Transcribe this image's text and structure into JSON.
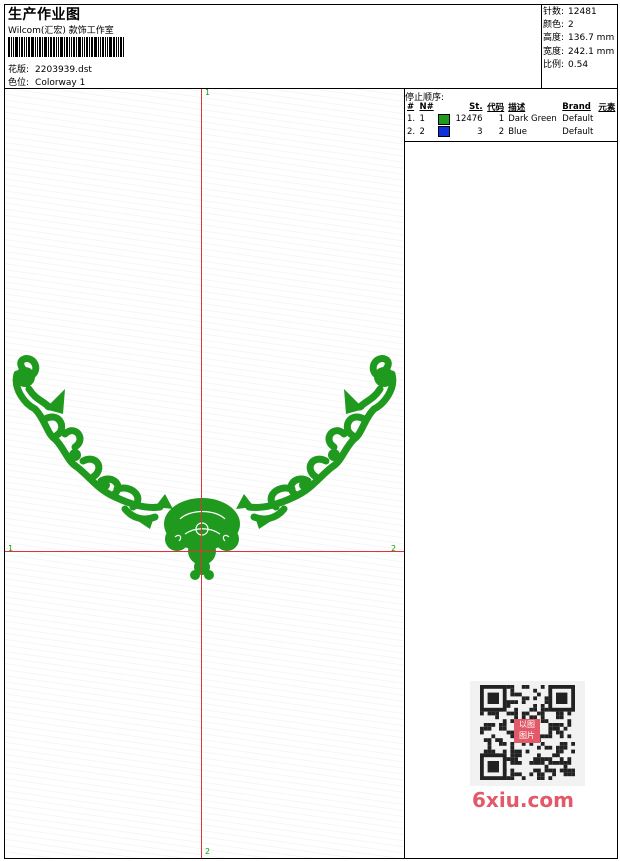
{
  "header": {
    "title": "生产作业图",
    "studio": "Wilcom(汇宏) 款饰工作室",
    "design_label": "花版:",
    "design_value": "2203939.dst",
    "colorway_label": "色位:",
    "colorway_value": "Colorway 1"
  },
  "stats": {
    "stitches_label": "针数:",
    "stitches_value": "12481",
    "colors_label": "颜色:",
    "colors_value": "2",
    "height_label": "高度:",
    "height_value": "136.7 mm",
    "width_label": "宽度:",
    "width_value": "242.1 mm",
    "scale_label": "比例:",
    "scale_value": "0.54"
  },
  "design_view": {
    "axis_top": "1",
    "axis_left": "1",
    "axis_right": "2",
    "axis_bottom": "2",
    "axis_color": "#e0303a",
    "thread_color": "#1f9a1f"
  },
  "stop_sequence": {
    "title": "停止顺序:",
    "headers": [
      "#",
      "N#",
      "St.",
      "代码",
      "描述",
      "Brand",
      "元素"
    ],
    "rows": [
      {
        "idx": "1.",
        "n": "1",
        "color": "#1f9a1f",
        "st": "12476",
        "code": "1",
        "desc": "Dark Green",
        "brand": "Default",
        "elem": ""
      },
      {
        "idx": "2.",
        "n": "2",
        "color": "#1030e0",
        "st": "3",
        "code": "2",
        "desc": "Blue",
        "brand": "Default",
        "elem": ""
      }
    ]
  },
  "watermark": {
    "text": "6xiu.com",
    "stamp": "以图 图片",
    "color": "#e25a6a"
  }
}
